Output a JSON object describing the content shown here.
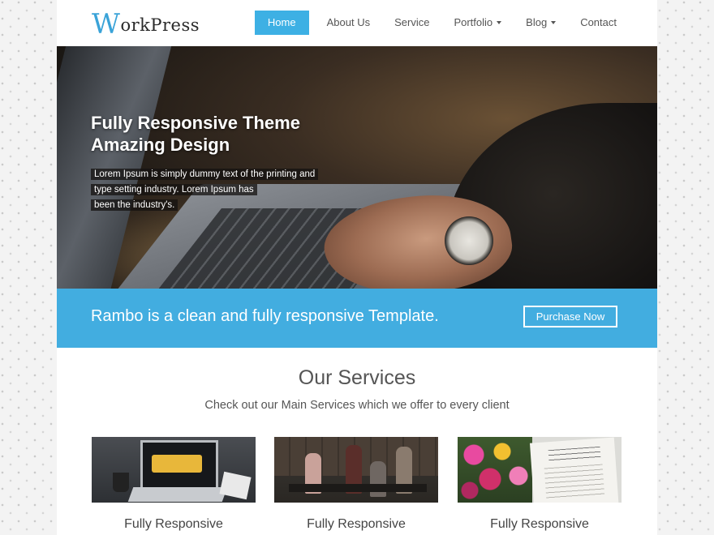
{
  "header": {
    "logo_initial": "W",
    "logo_rest": "orkPress",
    "nav": [
      {
        "label": "Home",
        "active": true,
        "dropdown": false
      },
      {
        "label": "About Us",
        "active": false,
        "dropdown": false
      },
      {
        "label": "Service",
        "active": false,
        "dropdown": false
      },
      {
        "label": "Portfolio",
        "active": false,
        "dropdown": true
      },
      {
        "label": "Blog",
        "active": false,
        "dropdown": true
      },
      {
        "label": "Contact",
        "active": false,
        "dropdown": false
      }
    ]
  },
  "hero": {
    "title_line1": "Fully Responsive Theme",
    "title_line2": "Amazing Design",
    "text_line1": "Lorem Ipsum is simply dummy text of the printing and",
    "text_line2": "type setting industry. Lorem Ipsum has",
    "text_line3": "been the industry's."
  },
  "callout": {
    "text": "Rambo is a clean and fully responsive Template.",
    "button_label": "Purchase Now"
  },
  "services": {
    "title": "Our Services",
    "subtitle": "Check out our Main Services which we offer to every client",
    "cards": [
      {
        "title": "Fully Responsive"
      },
      {
        "title": "Fully Responsive"
      },
      {
        "title": "Fully Responsive"
      }
    ]
  },
  "colors": {
    "accent": "#3db0e4",
    "callout_bg": "#42ade0",
    "logo_initial": "#3aa3d8"
  }
}
